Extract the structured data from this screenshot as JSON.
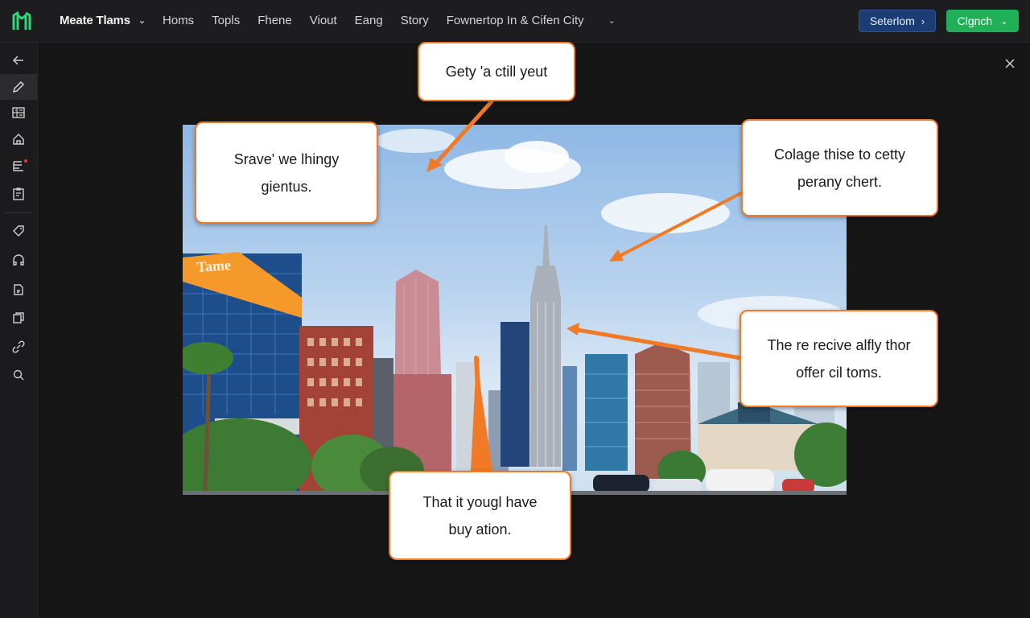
{
  "app": {
    "team_name": "Meate Tlams"
  },
  "nav": {
    "items": [
      "Homs",
      "Topls",
      "Fhene",
      "Viout",
      "Eang",
      "Story"
    ],
    "breadcrumb": "Fownertop In & Cifen City"
  },
  "actions": {
    "primary_label": "Seterlom",
    "cta_label": "Clgnch"
  },
  "callouts": [
    {
      "line1": "Getу 'a ctill yeut",
      "line2": ""
    },
    {
      "line1": "Srave' we lhingy",
      "line2": "gientus."
    },
    {
      "line1": "Colage thise to cetty",
      "line2": "perany chert."
    },
    {
      "line1": "The re recive alfly thor",
      "line2": "offer cil toms."
    },
    {
      "line1": "That it yougl have",
      "line2": "buy ation."
    }
  ],
  "image": {
    "sign_text": "Tame"
  },
  "colors": {
    "accent": "#f07a26",
    "cta": "#1fb058",
    "primary": "#1b3d73"
  },
  "icons": {
    "sidebar": [
      "back-arrow-icon",
      "pencil-icon",
      "grid-icon",
      "home-icon",
      "list-icon",
      "clipboard-icon",
      "tag-icon",
      "headphones-icon",
      "document-icon",
      "copy-icon",
      "link-icon",
      "search-icon"
    ],
    "close": "close-icon"
  }
}
